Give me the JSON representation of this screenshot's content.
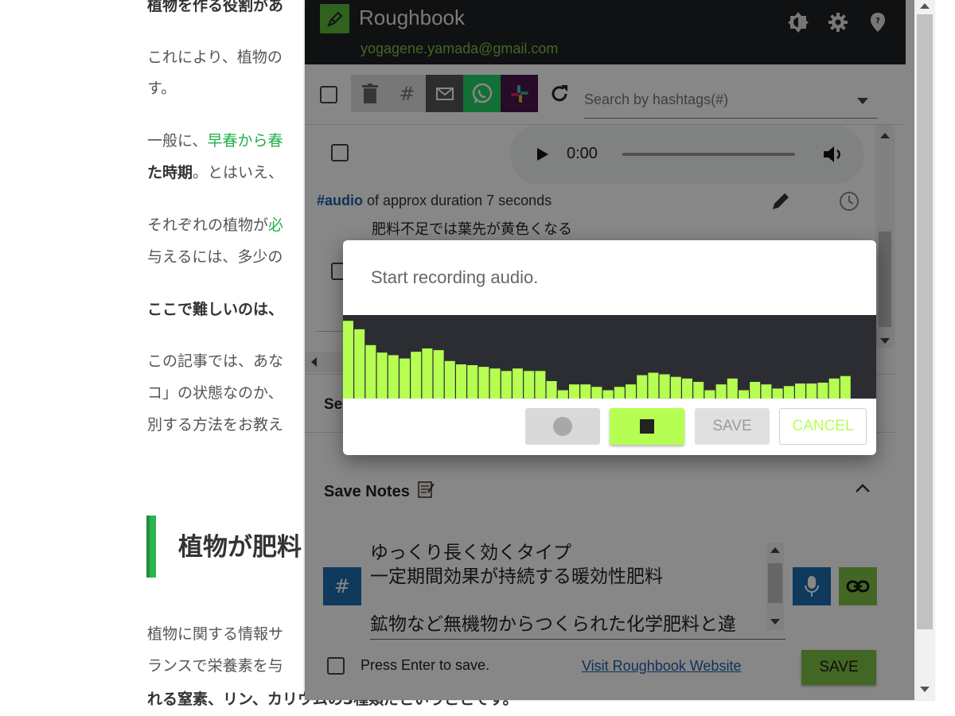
{
  "article": {
    "line1": "植物を作る役割があ",
    "line2a": "これにより、植物の",
    "line2b": "す。",
    "line3a_plain": "一般に、",
    "line3a_green": "早春から春",
    "line3b_bold": "た時期",
    "line3b_plain": "。とはいえ、",
    "line4a": "それぞれの植物が",
    "line4a_green": "必",
    "line4b": "与えるには、多少の",
    "line5": "ここで難しいのは、",
    "line6a": "この記事では、あな",
    "line6b": "コ」の状態なのか、",
    "line6c": "別する方法をお教え",
    "heading": "植物が肥料",
    "line7a": "植物に関する情報サ",
    "line7b": "ランスで栄養素を与",
    "line7c": "れる窒素、リン、カリウムの3種類だということです。"
  },
  "popup": {
    "app_title": "Roughbook",
    "user_email": "yogagene.yamada@gmail.com",
    "search_placeholder": "Search by hashtags(#)",
    "audio_time": "0:00",
    "note_tag": "#audio",
    "note_meta": " of approx duration 7 seconds",
    "note_text": "肥料不足では葉先が黄色くなる",
    "section_label": "Se",
    "save_title": "Save Notes",
    "hash_label": "#",
    "textarea_text": "ゆっくり長く効くタイプ\n一定期間効果が持続する暖効性肥料\n\n鉱物など無機物からつくられた化学肥料と違",
    "enter_label": "Press Enter to save.",
    "site_link": "Visit Roughbook Website",
    "save_label": "SAVE"
  },
  "modal": {
    "message": "Start recording audio.",
    "save_label": "SAVE",
    "cancel_label": "CANCEL",
    "levels": [
      0.93,
      0.83,
      0.64,
      0.55,
      0.52,
      0.48,
      0.56,
      0.6,
      0.58,
      0.45,
      0.41,
      0.4,
      0.38,
      0.36,
      0.33,
      0.36,
      0.33,
      0.33,
      0.21,
      0.1,
      0.17,
      0.17,
      0.14,
      0.1,
      0.14,
      0.17,
      0.28,
      0.31,
      0.29,
      0.26,
      0.24,
      0.2,
      0.1,
      0.17,
      0.24,
      0.1,
      0.2,
      0.17,
      0.12,
      0.15,
      0.18,
      0.18,
      0.19,
      0.24,
      0.27
    ]
  },
  "colors": {
    "topbar": "#1f2024",
    "accent_green": "#7ec244",
    "lime": "#b6ff52",
    "blue": "#1e6db0",
    "visualizer_bg": "#2b2d33"
  }
}
